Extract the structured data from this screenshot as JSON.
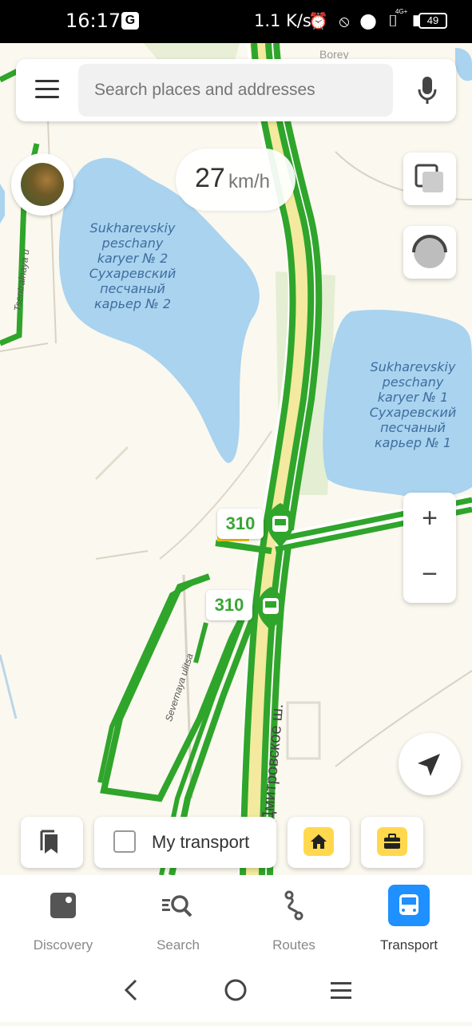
{
  "status_bar": {
    "time": "16:17",
    "network_speed": "1.1 K/s",
    "network_type": "4G+",
    "battery": "49"
  },
  "search": {
    "placeholder": "Search places and addresses"
  },
  "speed": {
    "value": "27",
    "unit": "km/h"
  },
  "map": {
    "lakes": [
      {
        "label": "Sukharevskiy\npeschany\nkaryer № 2\nСухаревский\nпесчаный\nкарьер № 2"
      },
      {
        "label": "Sukharevskiy\npeschany\nkaryer № 1\nСухаревский\nпесчаный\nкарьер № 1"
      }
    ],
    "streets": {
      "tsentralnaya": "Tsentralnaya u",
      "severnaya": "Severnaya ulitsa",
      "dmitrovskoe": "Дмитровское ш.",
      "borey": "Borey"
    },
    "route_badges": [
      {
        "number": "310"
      },
      {
        "number": "310"
      }
    ]
  },
  "controls": {
    "zoom_in": "+",
    "zoom_out": "−"
  },
  "bottom_row": {
    "my_transport_label": "My transport"
  },
  "tabs": [
    {
      "label": "Discovery",
      "icon": "discovery-icon"
    },
    {
      "label": "Search",
      "icon": "search-icon"
    },
    {
      "label": "Routes",
      "icon": "routes-icon"
    },
    {
      "label": "Transport",
      "icon": "bus-icon",
      "active": true
    }
  ],
  "colors": {
    "route_green": "#2fa52b",
    "water": "#a9d3ef",
    "accent_blue": "#1e90ff",
    "chip_yellow": "#ffd84d"
  }
}
